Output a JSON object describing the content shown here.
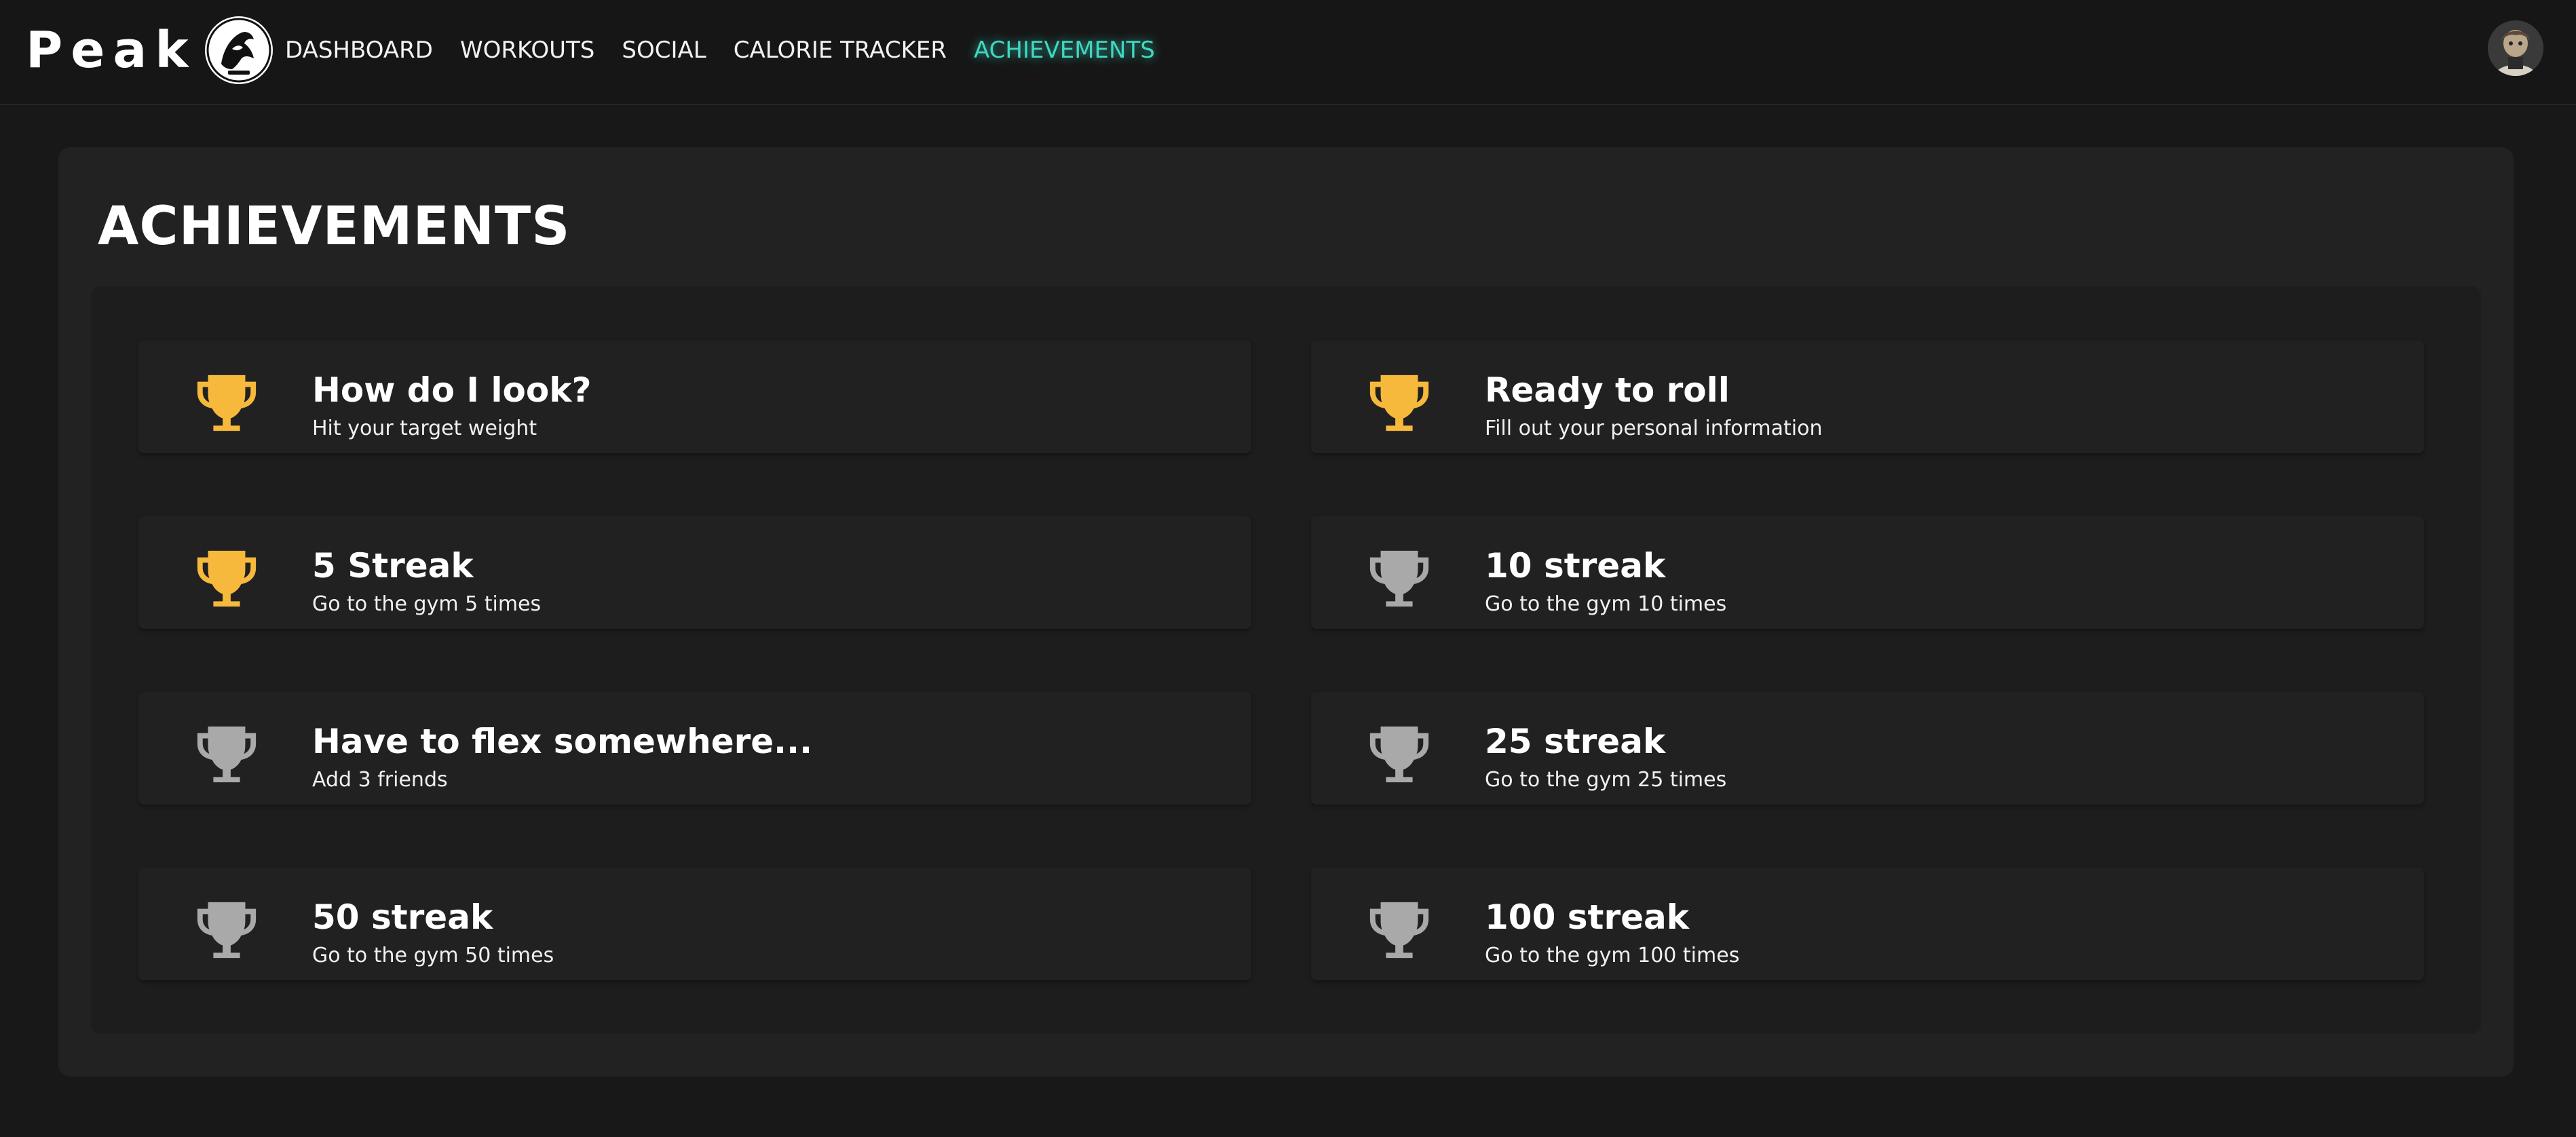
{
  "brand": {
    "name": "Peak",
    "logo_text": "PEAK"
  },
  "nav": {
    "links": [
      {
        "label": "DASHBOARD"
      },
      {
        "label": "WORKOUTS"
      },
      {
        "label": "SOCIAL"
      },
      {
        "label": "CALORIE TRACKER"
      },
      {
        "label": "ACHIEVEMENTS",
        "active": true
      }
    ],
    "active_color": "#3fd8c2"
  },
  "page": {
    "title": "ACHIEVEMENTS"
  },
  "colors": {
    "trophy_unlocked": "#f6b93b",
    "trophy_locked": "#a9a9a9"
  },
  "achievements": [
    {
      "title": "How do I look?",
      "description": "Hit your target weight",
      "unlocked": true,
      "icon": "trophy-icon"
    },
    {
      "title": "Ready to roll",
      "description": "Fill out your personal information",
      "unlocked": true,
      "icon": "trophy-icon"
    },
    {
      "title": "5 Streak",
      "description": "Go to the gym 5 times",
      "unlocked": true,
      "icon": "trophy-icon"
    },
    {
      "title": "10 streak",
      "description": "Go to the gym 10 times",
      "unlocked": false,
      "icon": "trophy-icon"
    },
    {
      "title": "Have to flex somewhere...",
      "description": "Add 3 friends",
      "unlocked": false,
      "icon": "trophy-icon"
    },
    {
      "title": "25 streak",
      "description": "Go to the gym 25 times",
      "unlocked": false,
      "icon": "trophy-icon"
    },
    {
      "title": "50 streak",
      "description": "Go to the gym 50 times",
      "unlocked": false,
      "icon": "trophy-icon"
    },
    {
      "title": "100 streak",
      "description": "Go to the gym 100 times",
      "unlocked": false,
      "icon": "trophy-icon"
    }
  ]
}
